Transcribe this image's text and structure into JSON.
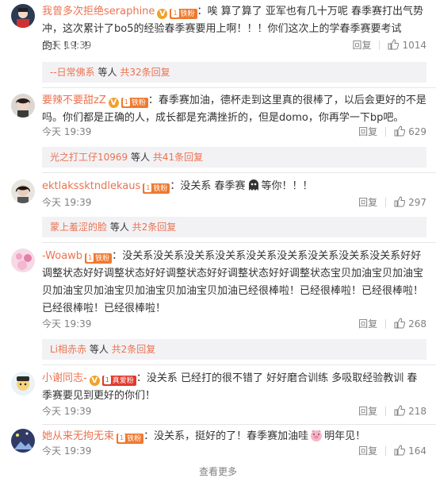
{
  "comments": [
    {
      "username": "我曾多次拒绝seraphine",
      "badge_level": "铁粉",
      "text": "唉 算了算了 亚军也有几十万呢 春季赛打出气势冲，这次累计了bo5的经验春季赛要用上啊！！！你们这次上的学春季赛要考试的！！！！",
      "time": "今天 19:39",
      "reply_label": "回复",
      "likes": "1014",
      "reply_summary": {
        "name": "--日常佛系",
        "middle": " 等人 ",
        "link": "共32条回复"
      }
    },
    {
      "username": "要辣不要甜zZ",
      "badge_level": "铁粉",
      "text": "春季赛加油，德杯走到这里真的很棒了，以后会更好的不是吗。你们都是正确的人，成长都是充满挫折的，但是domo，你再学一下bp吧。",
      "time": "今天 19:39",
      "reply_label": "回复",
      "likes": "629",
      "reply_summary": {
        "name": "光之打工仔10969",
        "middle": " 等人 ",
        "link": "共41条回复"
      }
    },
    {
      "username": "ektlakssktndlekaus",
      "badge_level": "铁粉",
      "text_before": "没关系 春季赛",
      "text_after": "等你！！！",
      "emoji": "ghost-emoji",
      "time": "今天 19:39",
      "reply_label": "回复",
      "likes": "297",
      "reply_summary": {
        "name": "蒙上羞涩的脸",
        "middle": " 等人 ",
        "link": "共2条回复"
      }
    },
    {
      "username": "-Woawb",
      "badge_level": "铁粉",
      "text": "没关系没关系没关系没关系没关系没关系没关系没关系没关系好好调整状态好好调整状态好好调整状态好好调整状态好好调整状态宝贝加油宝贝加油宝贝加油宝贝加油宝贝加油宝贝加油宝贝加油已经很棒啦！已经很棒啦！已经很棒啦！已经很棒啦！已经很棒啦！",
      "time": "今天 19:39",
      "reply_label": "回复",
      "likes": "268",
      "reply_summary": {
        "name": "Li相赤赤",
        "middle": " 等人 ",
        "link": "共2条回复"
      }
    },
    {
      "username": "小谢同志-",
      "badge_level": "真爱粉",
      "text": "没关系 已经打的很不错了 好好磨合训练 多吸取经验教训 春季赛要见到更好的你们！",
      "time": "今天 19:39",
      "reply_label": "回复",
      "likes": "218"
    },
    {
      "username": "她从来无拘无束",
      "badge_level": "铁粉",
      "text_before": "没关系，挺好的了！春季赛加油哇",
      "text_after": "明年见！",
      "emoji": "pig-emoji",
      "time": "今天 19:39",
      "reply_label": "回复",
      "likes": "164"
    }
  ],
  "footer": {
    "more_label": "查看更多"
  },
  "colors": {
    "username": "#eb7350",
    "badge_orange": "#f0792f",
    "badge_red": "#e23a2e",
    "v_badge": "#f0a22b",
    "reply_bg": "#f2f2f5"
  }
}
